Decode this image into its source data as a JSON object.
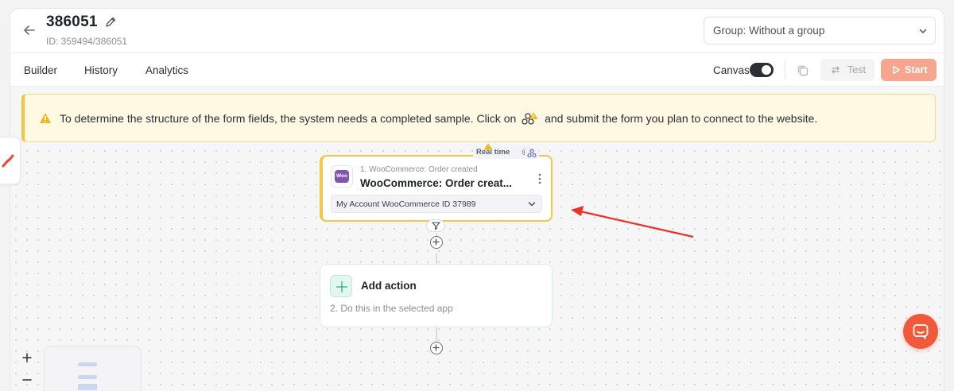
{
  "header": {
    "title": "386051",
    "subtitle": "ID: 359494/386051",
    "group_select": "Group: Without a group"
  },
  "tabs": [
    {
      "label": "Builder"
    },
    {
      "label": "History"
    },
    {
      "label": "Analytics"
    }
  ],
  "toolbar": {
    "canvas_label": "Canvas",
    "canvas_toggle_on": true,
    "test_label": "Test",
    "start_label": "Start"
  },
  "warning": {
    "text_before": "To determine the structure of the form fields, the system needs a completed sample. Click on",
    "text_after": "and submit the form you plan to connect to the website."
  },
  "trigger": {
    "step_label": "1. WooCommerce: Order created",
    "title": "WooCommerce: Order creat...",
    "app_logo_text": "Woo",
    "badge": "Real time",
    "account": "My Account WooCommerce ID 37989"
  },
  "action": {
    "title": "Add action",
    "subtitle": "2. Do this in the selected app"
  },
  "colors": {
    "accent_start": "#f6a58f",
    "warning_bg": "#fff8e3",
    "trigger_border": "#f1c84a",
    "woo_purple": "#7f54b3",
    "chat_button": "#f05a3a",
    "annotation_arrow": "#e8332a"
  },
  "icons": {
    "back": "arrow-left-icon",
    "edit": "pencil-icon",
    "chevron": "chevron-down-icon",
    "copy": "copy-icon",
    "test": "swap-arrows-icon",
    "start": "play-icon",
    "warning": "warning-triangle-icon",
    "webhook": "webhook-icon",
    "filter": "filter-icon",
    "add": "plus-circle-icon",
    "chat": "chat-icon"
  }
}
